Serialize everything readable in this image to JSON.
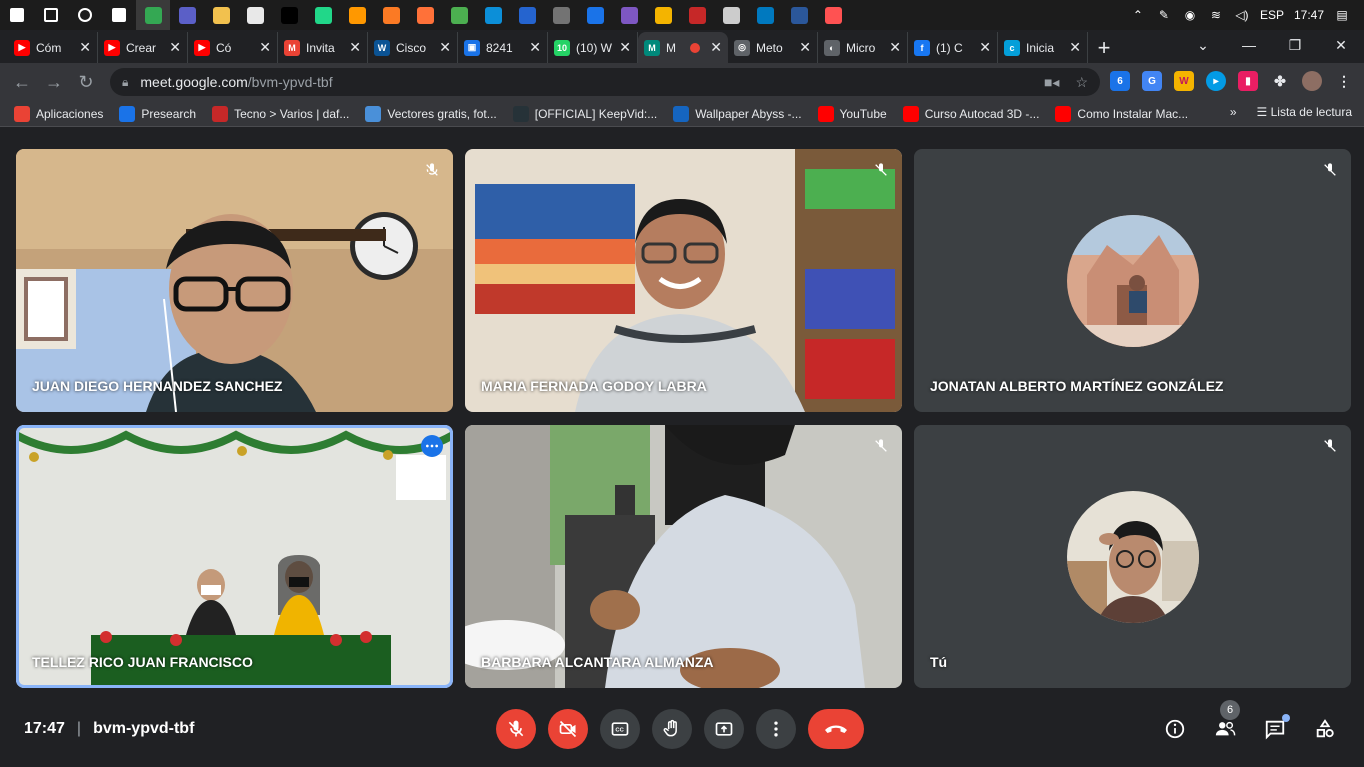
{
  "taskbar": {
    "apps": [
      {
        "name": "windows-start-icon",
        "color": "#ffffff"
      },
      {
        "name": "search-icon",
        "color": "#ffffff"
      },
      {
        "name": "cortana-icon",
        "color": "#ffffff"
      },
      {
        "name": "task-view-icon",
        "color": "#ffffff"
      },
      {
        "name": "chrome-icon",
        "color": "#34a853",
        "active": true
      },
      {
        "name": "teams-icon",
        "color": "#5b5fc7"
      },
      {
        "name": "file-explorer-icon",
        "color": "#f2c14e"
      },
      {
        "name": "app-icon",
        "color": "#e8e8e8"
      },
      {
        "name": "intellij-icon",
        "color": "#000000"
      },
      {
        "name": "pycharm-icon",
        "color": "#21d789"
      },
      {
        "name": "sublime-icon",
        "color": "#ff9800"
      },
      {
        "name": "xampp-icon",
        "color": "#fb7a24"
      },
      {
        "name": "firefox-icon",
        "color": "#ff7139"
      },
      {
        "name": "app-icon",
        "color": "#4caf50"
      },
      {
        "name": "edge-icon",
        "color": "#0c8fd8"
      },
      {
        "name": "todo-icon",
        "color": "#2564cf"
      },
      {
        "name": "calculator-icon",
        "color": "#737373"
      },
      {
        "name": "virtualbox-icon",
        "color": "#1a73e8"
      },
      {
        "name": "vs-icon",
        "color": "#7e57c2"
      },
      {
        "name": "app-icon",
        "color": "#f4b400"
      },
      {
        "name": "app-icon",
        "color": "#c62828"
      },
      {
        "name": "settings-icon",
        "color": "#cccccc"
      },
      {
        "name": "trello-icon",
        "color": "#0079bf"
      },
      {
        "name": "word-icon",
        "color": "#2b579a"
      },
      {
        "name": "app-icon",
        "color": "#ff5252"
      }
    ],
    "language": "ESP",
    "time": "17:47"
  },
  "browser": {
    "tabs": [
      {
        "title": "Cóm",
        "color": "#ff0000",
        "glyph": "▶"
      },
      {
        "title": "Crear",
        "color": "#ff0000",
        "glyph": "▶"
      },
      {
        "title": "Có",
        "color": "#ff0000",
        "glyph": "▶"
      },
      {
        "title": "Invita",
        "color": "#ea4335",
        "glyph": "M"
      },
      {
        "title": "Cisco",
        "color": "#0b5394",
        "glyph": "W"
      },
      {
        "title": "8241",
        "color": "#1a73e8",
        "glyph": "▣"
      },
      {
        "title": "(10) W",
        "color": "#25d366",
        "glyph": "10"
      },
      {
        "title": "M",
        "color": "#00897b",
        "glyph": "M",
        "active": true
      },
      {
        "title": "Meto",
        "color": "#5f6368",
        "glyph": "◎"
      },
      {
        "title": "Micro",
        "color": "#5f6368",
        "glyph": "◐"
      },
      {
        "title": "(1) C",
        "color": "#1877f2",
        "glyph": "f"
      },
      {
        "title": "Inicia",
        "color": "#049fd9",
        "glyph": "c"
      }
    ],
    "url_host": "meet.google.com",
    "url_path": "/bvm-ypvd-tbf",
    "bookmarks": [
      {
        "label": "Aplicaciones",
        "color": "#ea4335"
      },
      {
        "label": "Presearch",
        "color": "#1a73e8"
      },
      {
        "label": "Tecno > Varios | daf...",
        "color": "#c62828"
      },
      {
        "label": "Vectores gratis, fot...",
        "color": "#4a90d9"
      },
      {
        "label": "[OFFICIAL] KeepVid:...",
        "color": "#263238"
      },
      {
        "label": "Wallpaper Abyss -...",
        "color": "#1565c0"
      },
      {
        "label": "YouTube",
        "color": "#ff0000"
      },
      {
        "label": "Curso Autocad 3D -...",
        "color": "#ff0000"
      },
      {
        "label": "Como Instalar Mac...",
        "color": "#ff0000"
      }
    ],
    "reading_list": "Lista de lectura"
  },
  "participants": [
    {
      "name": "JUAN DIEGO HERNANDEZ SANCHEZ"
    },
    {
      "name": "MARIA FERNADA GODOY LABRA"
    },
    {
      "name": "JONATAN ALBERTO MARTÍNEZ GONZÁLEZ"
    },
    {
      "name": "TELLEZ RICO JUAN FRANCISCO"
    },
    {
      "name": "BARBARA ALCANTARA ALMANZA"
    },
    {
      "name": "Tú"
    }
  ],
  "meeting": {
    "time": "17:47",
    "code": "bvm-ypvd-tbf",
    "participant_count": "6"
  }
}
